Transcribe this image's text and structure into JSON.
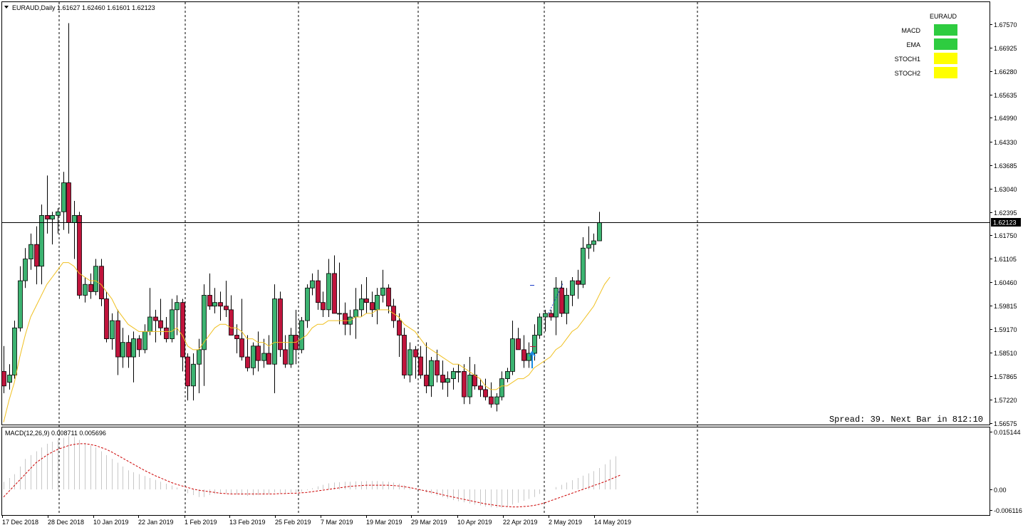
{
  "main_chart": {
    "header": "EURAUD,Daily  1.61627 1.62460 1.61601 1.62123",
    "price_ticks": [
      "1.67570",
      "1.66925",
      "1.66280",
      "1.65635",
      "1.64990",
      "1.64330",
      "1.63685",
      "1.63040",
      "1.62395",
      "1.61750",
      "1.61105",
      "1.60460",
      "1.59815",
      "1.59170",
      "1.58510",
      "1.57865",
      "1.57220",
      "1.56575"
    ],
    "current_price": "1.62123",
    "footer": "Spread: 39. Next Bar in 812:10",
    "colors": {
      "bull": "#3cb371",
      "bear": "#c0143c",
      "ema": "#f0c020",
      "crosshair": "#000000",
      "price_badge": "#000000"
    }
  },
  "indicator_panel": {
    "title": "EURAUD",
    "rows": [
      {
        "label": "MACD",
        "color": "#2ecc40"
      },
      {
        "label": "EMA",
        "color": "#2ecc40"
      },
      {
        "label": "STOCH1",
        "color": "#ffff00"
      },
      {
        "label": "STOCH2",
        "color": "#ffff00"
      }
    ]
  },
  "macd": {
    "header": "MACD(12,26,9) 0.008711 0.005696",
    "ticks": [
      "0.015144",
      "0.00",
      "-0.006116"
    ],
    "colors": {
      "histogram": "#c8c8c8",
      "signal": "#cc0000"
    }
  },
  "time_axis": {
    "labels": [
      "17 Dec 2018",
      "28 Dec 2018",
      "10 Jan 2019",
      "22 Jan 2019",
      "1 Feb 2019",
      "13 Feb 2019",
      "25 Feb 2019",
      "7 Mar 2019",
      "19 Mar 2019",
      "29 Mar 2019",
      "10 Apr 2019",
      "22 Apr 2019",
      "2 May 2019",
      "14 May 2019"
    ]
  },
  "chart_data": {
    "type": "candlestick",
    "symbol": "EURAUD",
    "timeframe": "Daily",
    "ylim": [
      1.56575,
      1.6757
    ],
    "last": {
      "open": 1.61627,
      "high": 1.6246,
      "low": 1.61601,
      "close": 1.62123
    },
    "candles": [
      [
        1.58,
        1.587,
        1.574,
        1.576
      ],
      [
        1.577,
        1.582,
        1.575,
        1.579
      ],
      [
        1.579,
        1.594,
        1.578,
        1.592
      ],
      [
        1.592,
        1.609,
        1.591,
        1.605
      ],
      [
        1.605,
        1.614,
        1.603,
        1.611
      ],
      [
        1.611,
        1.618,
        1.608,
        1.615
      ],
      [
        1.615,
        1.62,
        1.604,
        1.609
      ],
      [
        1.609,
        1.626,
        1.604,
        1.623
      ],
      [
        1.623,
        1.634,
        1.618,
        1.622
      ],
      [
        1.622,
        1.624,
        1.615,
        1.623
      ],
      [
        1.623,
        1.625,
        1.618,
        1.624
      ],
      [
        1.624,
        1.635,
        1.619,
        1.632
      ],
      [
        1.632,
        1.676,
        1.618,
        1.621
      ],
      [
        1.621,
        1.627,
        1.611,
        1.623
      ],
      [
        1.623,
        1.624,
        1.6,
        1.601
      ],
      [
        1.601,
        1.606,
        1.599,
        1.604
      ],
      [
        1.604,
        1.607,
        1.6,
        1.602
      ],
      [
        1.602,
        1.611,
        1.601,
        1.609
      ],
      [
        1.609,
        1.611,
        1.598,
        1.6
      ],
      [
        1.6,
        1.602,
        1.588,
        1.589
      ],
      [
        1.589,
        1.596,
        1.586,
        1.594
      ],
      [
        1.594,
        1.597,
        1.579,
        1.584
      ],
      [
        1.584,
        1.592,
        1.581,
        1.588
      ],
      [
        1.588,
        1.59,
        1.581,
        1.584
      ],
      [
        1.584,
        1.591,
        1.577,
        1.589
      ],
      [
        1.589,
        1.59,
        1.584,
        1.586
      ],
      [
        1.586,
        1.593,
        1.585,
        1.591
      ],
      [
        1.591,
        1.603,
        1.59,
        1.595
      ],
      [
        1.595,
        1.597,
        1.588,
        1.594
      ],
      [
        1.594,
        1.6,
        1.59,
        1.592
      ],
      [
        1.592,
        1.595,
        1.588,
        1.589
      ],
      [
        1.589,
        1.6,
        1.588,
        1.597
      ],
      [
        1.597,
        1.601,
        1.59,
        1.599
      ],
      [
        1.599,
        1.6,
        1.58,
        1.584
      ],
      [
        1.584,
        1.585,
        1.572,
        1.576
      ],
      [
        1.576,
        1.585,
        1.572,
        1.582
      ],
      [
        1.582,
        1.589,
        1.574,
        1.586
      ],
      [
        1.586,
        1.604,
        1.576,
        1.601
      ],
      [
        1.601,
        1.607,
        1.597,
        1.598
      ],
      [
        1.598,
        1.603,
        1.596,
        1.599
      ],
      [
        1.599,
        1.602,
        1.594,
        1.598
      ],
      [
        1.598,
        1.605,
        1.595,
        1.597
      ],
      [
        1.597,
        1.601,
        1.59,
        1.59
      ],
      [
        1.59,
        1.593,
        1.585,
        1.589
      ],
      [
        1.589,
        1.6,
        1.583,
        1.584
      ],
      [
        1.584,
        1.59,
        1.58,
        1.581
      ],
      [
        1.581,
        1.588,
        1.579,
        1.587
      ],
      [
        1.587,
        1.591,
        1.58,
        1.583
      ],
      [
        1.583,
        1.589,
        1.581,
        1.585
      ],
      [
        1.585,
        1.59,
        1.582,
        1.582
      ],
      [
        1.582,
        1.604,
        1.574,
        1.6
      ],
      [
        1.6,
        1.602,
        1.584,
        1.586
      ],
      [
        1.586,
        1.59,
        1.581,
        1.582
      ],
      [
        1.582,
        1.592,
        1.581,
        1.59
      ],
      [
        1.59,
        1.597,
        1.582,
        1.586
      ],
      [
        1.586,
        1.595,
        1.585,
        1.594
      ],
      [
        1.594,
        1.604,
        1.592,
        1.603
      ],
      [
        1.603,
        1.607,
        1.601,
        1.605
      ],
      [
        1.605,
        1.608,
        1.597,
        1.599
      ],
      [
        1.599,
        1.602,
        1.595,
        1.597
      ],
      [
        1.597,
        1.611,
        1.595,
        1.607
      ],
      [
        1.607,
        1.612,
        1.596,
        1.596
      ],
      [
        1.596,
        1.61,
        1.593,
        1.596
      ],
      [
        1.596,
        1.599,
        1.59,
        1.593
      ],
      [
        1.593,
        1.597,
        1.59,
        1.595
      ],
      [
        1.595,
        1.603,
        1.589,
        1.597
      ],
      [
        1.597,
        1.604,
        1.595,
        1.6
      ],
      [
        1.6,
        1.606,
        1.596,
        1.599
      ],
      [
        1.599,
        1.602,
        1.595,
        1.597
      ],
      [
        1.597,
        1.603,
        1.593,
        1.601
      ],
      [
        1.601,
        1.608,
        1.599,
        1.603
      ],
      [
        1.603,
        1.604,
        1.596,
        1.598
      ],
      [
        1.598,
        1.6,
        1.592,
        1.594
      ],
      [
        1.594,
        1.596,
        1.584,
        1.59
      ],
      [
        1.59,
        1.592,
        1.578,
        1.579
      ],
      [
        1.579,
        1.588,
        1.577,
        1.586
      ],
      [
        1.586,
        1.587,
        1.578,
        1.584
      ],
      [
        1.584,
        1.587,
        1.578,
        1.579
      ],
      [
        1.579,
        1.588,
        1.574,
        1.576
      ],
      [
        1.576,
        1.584,
        1.573,
        1.583
      ],
      [
        1.583,
        1.586,
        1.577,
        1.579
      ],
      [
        1.579,
        1.583,
        1.575,
        1.577
      ],
      [
        1.577,
        1.58,
        1.573,
        1.578
      ],
      [
        1.578,
        1.581,
        1.575,
        1.58
      ],
      [
        1.58,
        1.582,
        1.577,
        1.58
      ],
      [
        1.58,
        1.582,
        1.571,
        1.573
      ],
      [
        1.573,
        1.584,
        1.571,
        1.579
      ],
      [
        1.579,
        1.582,
        1.575,
        1.576
      ],
      [
        1.576,
        1.578,
        1.573,
        1.575
      ],
      [
        1.575,
        1.578,
        1.572,
        1.573
      ],
      [
        1.573,
        1.577,
        1.57,
        1.571
      ],
      [
        1.571,
        1.574,
        1.569,
        1.573
      ],
      [
        1.573,
        1.58,
        1.572,
        1.578
      ],
      [
        1.578,
        1.581,
        1.577,
        1.58
      ],
      [
        1.58,
        1.594,
        1.579,
        1.589
      ],
      [
        1.589,
        1.592,
        1.586,
        1.586
      ],
      [
        1.586,
        1.59,
        1.581,
        1.583
      ],
      [
        1.583,
        1.588,
        1.581,
        1.585
      ],
      [
        1.585,
        1.593,
        1.583,
        1.59
      ],
      [
        1.59,
        1.596,
        1.589,
        1.595
      ],
      [
        1.595,
        1.597,
        1.591,
        1.596
      ],
      [
        1.596,
        1.597,
        1.594,
        1.595
      ],
      [
        1.595,
        1.606,
        1.59,
        1.603
      ],
      [
        1.603,
        1.605,
        1.595,
        1.596
      ],
      [
        1.596,
        1.603,
        1.593,
        1.601
      ],
      [
        1.601,
        1.606,
        1.598,
        1.605
      ],
      [
        1.605,
        1.608,
        1.6,
        1.604
      ],
      [
        1.604,
        1.617,
        1.603,
        1.614
      ],
      [
        1.614,
        1.62,
        1.611,
        1.615
      ],
      [
        1.615,
        1.618,
        1.613,
        1.616
      ],
      [
        1.616,
        1.624,
        1.616,
        1.621
      ]
    ],
    "ema": [
      1.566,
      1.572,
      1.577,
      1.584,
      1.59,
      1.595,
      1.598,
      1.601,
      1.604,
      1.606,
      1.608,
      1.61,
      1.61,
      1.609,
      1.607,
      1.606,
      1.605,
      1.605,
      1.604,
      1.602,
      1.6,
      1.597,
      1.595,
      1.593,
      1.592,
      1.591,
      1.591,
      1.591,
      1.591,
      1.591,
      1.591,
      1.591,
      1.592,
      1.59,
      1.587,
      1.586,
      1.586,
      1.588,
      1.59,
      1.592,
      1.593,
      1.593,
      1.592,
      1.592,
      1.591,
      1.589,
      1.589,
      1.588,
      1.588,
      1.587,
      1.588,
      1.588,
      1.588,
      1.588,
      1.588,
      1.589,
      1.59,
      1.592,
      1.593,
      1.593,
      1.594,
      1.594,
      1.594,
      1.594,
      1.594,
      1.595,
      1.595,
      1.596,
      1.596,
      1.597,
      1.597,
      1.597,
      1.596,
      1.595,
      1.593,
      1.592,
      1.591,
      1.589,
      1.587,
      1.586,
      1.585,
      1.584,
      1.583,
      1.582,
      1.582,
      1.581,
      1.58,
      1.579,
      1.578,
      1.576,
      1.575,
      1.575,
      1.576,
      1.576,
      1.577,
      1.578,
      1.578,
      1.579,
      1.581,
      1.582,
      1.583,
      1.584,
      1.586,
      1.587,
      1.589,
      1.591,
      1.592,
      1.594,
      1.596,
      1.598,
      1.601,
      1.604,
      1.606
    ],
    "macd_hist": [
      0.002,
      0.003,
      0.004,
      0.006,
      0.008,
      0.009,
      0.01,
      0.011,
      0.012,
      0.0125,
      0.013,
      0.0135,
      0.014,
      0.0138,
      0.013,
      0.0122,
      0.0115,
      0.011,
      0.01,
      0.009,
      0.008,
      0.007,
      0.006,
      0.005,
      0.0045,
      0.004,
      0.0035,
      0.003,
      0.0025,
      0.002,
      0.0015,
      0.001,
      0.0005,
      0.0,
      -0.001,
      -0.0015,
      -0.002,
      -0.002,
      -0.0015,
      -0.0012,
      -0.001,
      -0.001,
      -0.0012,
      -0.0013,
      -0.0015,
      -0.0017,
      -0.0016,
      -0.0015,
      -0.0014,
      -0.0012,
      -0.0008,
      -0.0009,
      -0.001,
      -0.0008,
      -0.0008,
      -0.0006,
      -0.0002,
      0.0003,
      0.0008,
      0.0012,
      0.0016,
      0.0018,
      0.0019,
      0.002,
      0.002,
      0.0021,
      0.0021,
      0.0022,
      0.0022,
      0.0022,
      0.0021,
      0.002,
      0.0018,
      0.0015,
      0.0011,
      0.0006,
      0.0002,
      -0.0003,
      -0.0008,
      -0.0012,
      -0.0016,
      -0.002,
      -0.0024,
      -0.0028,
      -0.0031,
      -0.0034,
      -0.0037,
      -0.004,
      -0.0042,
      -0.0045,
      -0.0047,
      -0.0048,
      -0.0048,
      -0.0045,
      -0.004,
      -0.0035,
      -0.003,
      -0.0025,
      -0.002,
      -0.0012,
      -0.0006,
      0.0,
      0.0006,
      0.0012,
      0.0018,
      0.0024,
      0.003,
      0.0036,
      0.0042,
      0.0048,
      0.0056,
      0.0066,
      0.0078,
      0.0087
    ],
    "macd_signal": [
      -0.002,
      -0.0005,
      0.001,
      0.0025,
      0.004,
      0.0055,
      0.007,
      0.008,
      0.009,
      0.0098,
      0.0105,
      0.011,
      0.0115,
      0.0118,
      0.012,
      0.012,
      0.0118,
      0.0115,
      0.011,
      0.0105,
      0.0098,
      0.009,
      0.0082,
      0.0074,
      0.0066,
      0.0058,
      0.005,
      0.0043,
      0.0036,
      0.003,
      0.0024,
      0.0018,
      0.0013,
      0.0009,
      0.0005,
      0.0001,
      -0.0002,
      -0.0004,
      -0.0006,
      -0.0008,
      -0.001,
      -0.0011,
      -0.0012,
      -0.0012,
      -0.0012,
      -0.0012,
      -0.0012,
      -0.0012,
      -0.0012,
      -0.0012,
      -0.0012,
      -0.0011,
      -0.0011,
      -0.001,
      -0.001,
      -0.0009,
      -0.0008,
      -0.0006,
      -0.0004,
      -0.0002,
      0.0,
      0.0002,
      0.0004,
      0.0006,
      0.0008,
      0.0009,
      0.001,
      0.0011,
      0.0011,
      0.0011,
      0.0011,
      0.0011,
      0.001,
      0.0009,
      0.0007,
      0.0005,
      0.0002,
      -0.0001,
      -0.0004,
      -0.0007,
      -0.001,
      -0.0014,
      -0.0017,
      -0.002,
      -0.0023,
      -0.0026,
      -0.0029,
      -0.0032,
      -0.0035,
      -0.0038,
      -0.004,
      -0.0042,
      -0.0044,
      -0.0045,
      -0.0046,
      -0.0046,
      -0.0045,
      -0.0044,
      -0.0042,
      -0.0039,
      -0.0035,
      -0.003,
      -0.0025,
      -0.002,
      -0.0015,
      -0.001,
      -0.0005,
      0.0,
      0.0005,
      0.001,
      0.0015,
      0.002,
      0.0026,
      0.0032,
      0.0038
    ]
  }
}
